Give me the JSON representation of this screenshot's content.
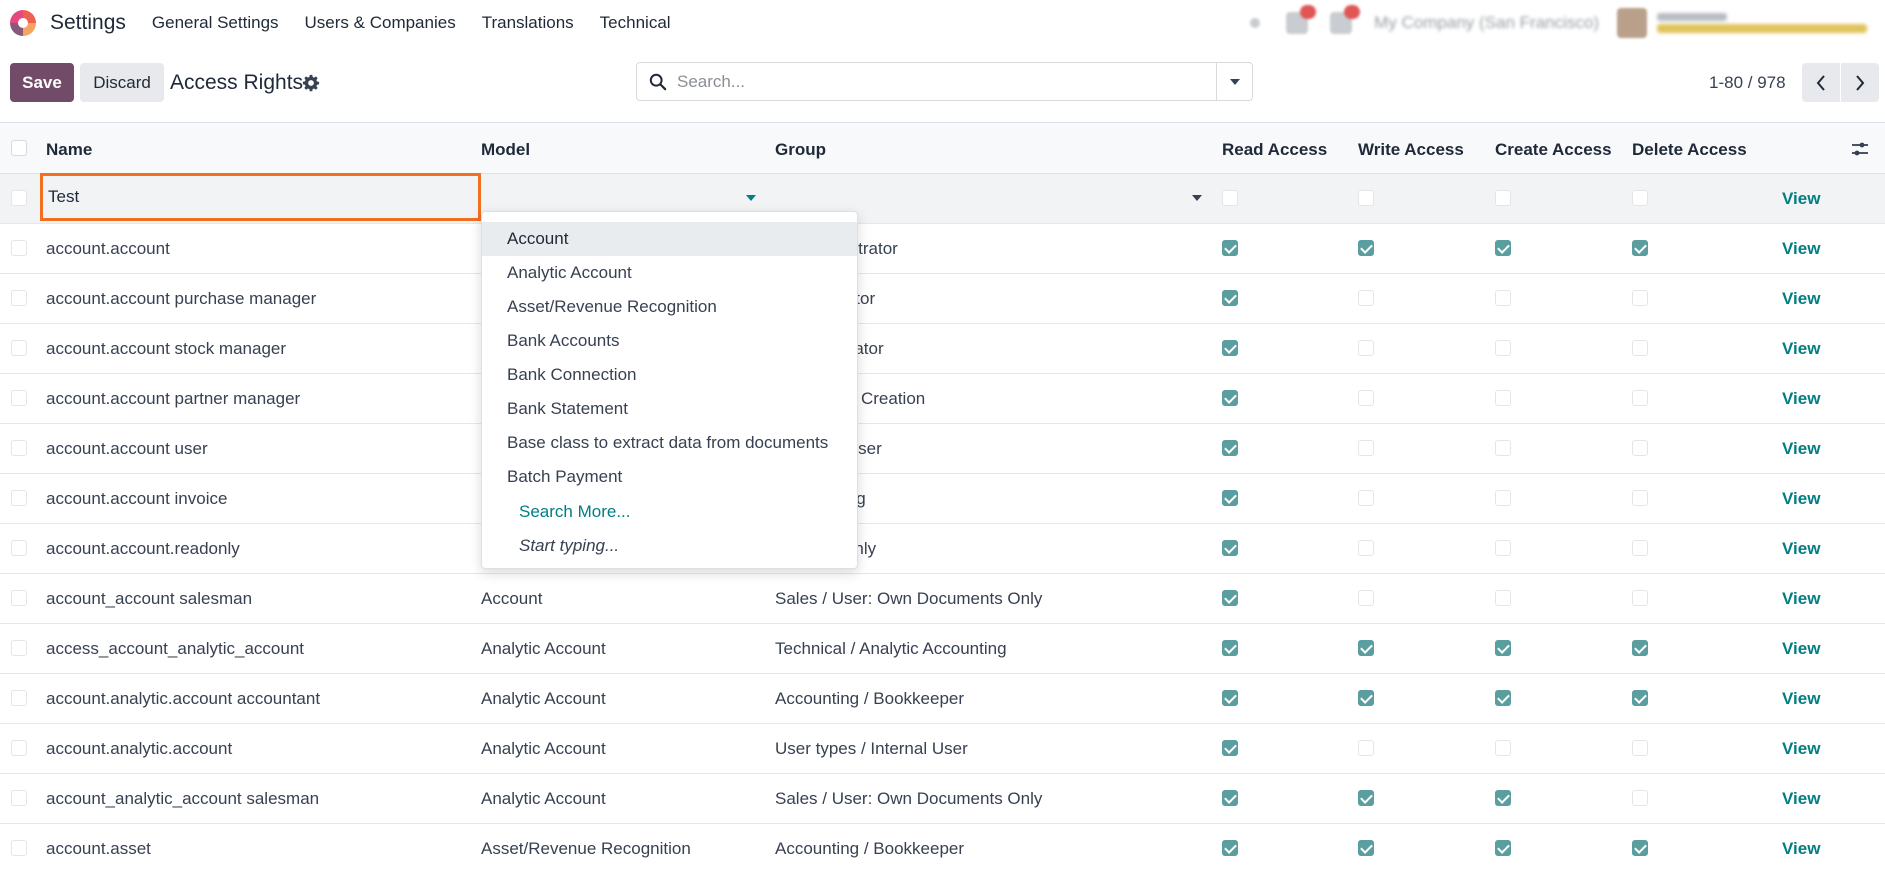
{
  "nav": {
    "app_title": "Settings",
    "menu": [
      "General Settings",
      "Users & Companies",
      "Translations",
      "Technical"
    ],
    "company": "My Company (San Francisco)"
  },
  "control": {
    "save_label": "Save",
    "discard_label": "Discard",
    "title": "Access Rights",
    "search_placeholder": "Search...",
    "pager": "1-80 / 978"
  },
  "columns": {
    "name": "Name",
    "model": "Model",
    "group": "Group",
    "read": "Read Access",
    "write": "Write Access",
    "create": "Create Access",
    "delete": "Delete Access"
  },
  "edit_row": {
    "name": "Test",
    "view": "View"
  },
  "rows": [
    {
      "name": "account.account",
      "model": "",
      "group": "g / Administrator",
      "read": true,
      "write": true,
      "create": true,
      "delete": true,
      "view": "View"
    },
    {
      "name": "account.account purchase manager",
      "model": "",
      "group": "Administrator",
      "read": true,
      "write": false,
      "create": false,
      "delete": false,
      "view": "View"
    },
    {
      "name": "account.account stock manager",
      "model": "",
      "group": "/ Administrator",
      "read": true,
      "write": false,
      "create": false,
      "delete": false,
      "view": "View"
    },
    {
      "name": "account.account partner manager",
      "model": "",
      "group": "s / Contact Creation",
      "read": true,
      "write": false,
      "create": false,
      "delete": false,
      "view": "View"
    },
    {
      "name": "account.account user",
      "model": "",
      "group": "/ Internal User",
      "read": true,
      "write": false,
      "create": false,
      "delete": false,
      "view": "View"
    },
    {
      "name": "account.account invoice",
      "model": "",
      "group": "g / Invoicing",
      "read": true,
      "write": false,
      "create": false,
      "delete": false,
      "view": "View"
    },
    {
      "name": "account.account.readonly",
      "model": "",
      "group": "g / Read-only",
      "read": true,
      "write": false,
      "create": false,
      "delete": false,
      "view": "View"
    },
    {
      "name": "account_account salesman",
      "model": "Account",
      "group": "Sales / User: Own Documents Only",
      "read": true,
      "write": false,
      "create": false,
      "delete": false,
      "view": "View"
    },
    {
      "name": "access_account_analytic_account",
      "model": "Analytic Account",
      "group": "Technical / Analytic Accounting",
      "read": true,
      "write": true,
      "create": true,
      "delete": true,
      "view": "View"
    },
    {
      "name": "account.analytic.account accountant",
      "model": "Analytic Account",
      "group": "Accounting / Bookkeeper",
      "read": true,
      "write": true,
      "create": true,
      "delete": true,
      "view": "View"
    },
    {
      "name": "account.analytic.account",
      "model": "Analytic Account",
      "group": "User types / Internal User",
      "read": true,
      "write": false,
      "create": false,
      "delete": false,
      "view": "View"
    },
    {
      "name": "account_analytic_account salesman",
      "model": "Analytic Account",
      "group": "Sales / User: Own Documents Only",
      "read": true,
      "write": true,
      "create": true,
      "delete": false,
      "view": "View"
    },
    {
      "name": "account.asset",
      "model": "Asset/Revenue Recognition",
      "group": "Accounting / Bookkeeper",
      "read": true,
      "write": true,
      "create": true,
      "delete": true,
      "view": "View"
    }
  ],
  "dropdown": {
    "items": [
      "Account",
      "Analytic Account",
      "Asset/Revenue Recognition",
      "Bank Accounts",
      "Bank Connection",
      "Bank Statement",
      "Base class to extract data from documents",
      "Batch Payment"
    ],
    "search_more": "Search More...",
    "start_typing": "Start typing..."
  },
  "colors": {
    "primary": "#714b67",
    "link": "#017e84",
    "checkbox": "#5b9ea0",
    "highlight": "#f26f21"
  }
}
